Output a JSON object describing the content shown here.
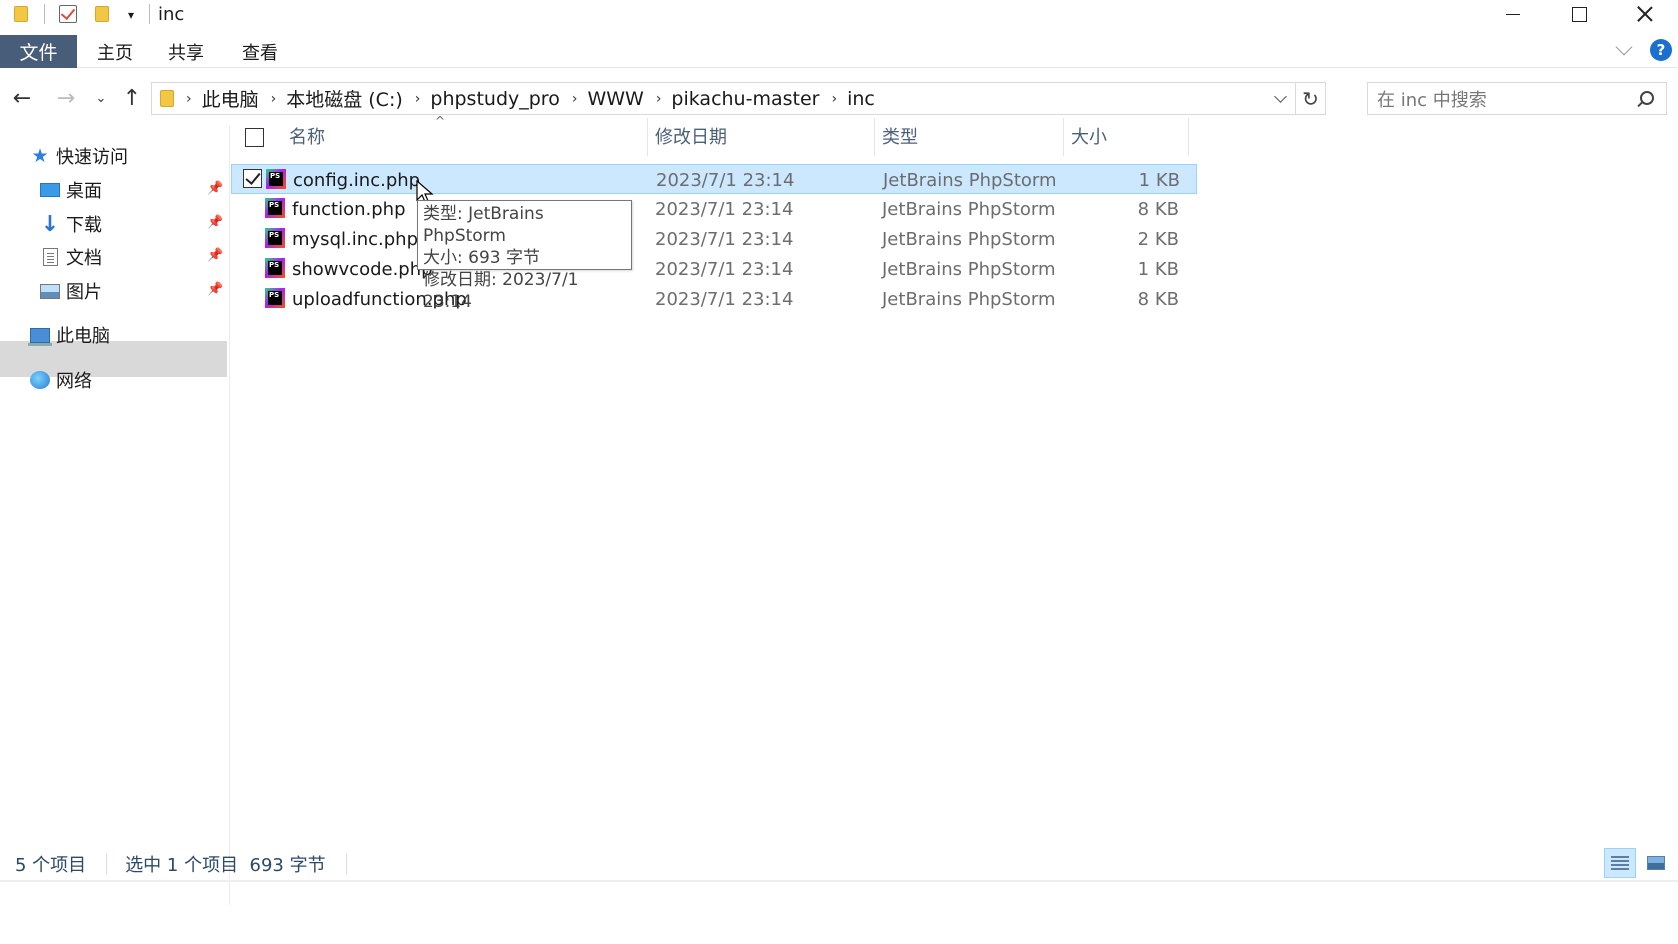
{
  "window": {
    "title": "inc"
  },
  "ribbon": {
    "file_tab": "文件",
    "tabs": [
      "主页",
      "共享",
      "查看"
    ]
  },
  "address": {
    "crumbs": [
      "此电脑",
      "本地磁盘 (C:)",
      "phpstudy_pro",
      "WWW",
      "pikachu-master",
      "inc"
    ]
  },
  "search": {
    "placeholder": "在 inc 中搜索"
  },
  "sidebar": {
    "quick_access": "快速访问",
    "items": [
      {
        "label": "桌面",
        "icon": "desktop-icon"
      },
      {
        "label": "下载",
        "icon": "download-icon"
      },
      {
        "label": "文档",
        "icon": "document-icon"
      },
      {
        "label": "图片",
        "icon": "pictures-icon"
      }
    ],
    "this_pc": "此电脑",
    "network": "网络"
  },
  "columns": {
    "name": "名称",
    "modified": "修改日期",
    "type": "类型",
    "size": "大小"
  },
  "files": [
    {
      "name": "config.inc.php",
      "modified": "2023/7/1 23:14",
      "type": "JetBrains PhpStorm",
      "size": "1 KB",
      "selected": true
    },
    {
      "name": "function.php",
      "modified": "2023/7/1 23:14",
      "type": "JetBrains PhpStorm",
      "size": "8 KB",
      "selected": false
    },
    {
      "name": "mysql.inc.php",
      "modified": "2023/7/1 23:14",
      "type": "JetBrains PhpStorm",
      "size": "2 KB",
      "selected": false
    },
    {
      "name": "showvcode.php",
      "modified": "2023/7/1 23:14",
      "type": "JetBrains PhpStorm",
      "size": "1 KB",
      "selected": false
    },
    {
      "name": "uploadfunction.php",
      "modified": "2023/7/1 23:14",
      "type": "JetBrains PhpStorm",
      "size": "8 KB",
      "selected": false
    }
  ],
  "tooltip": {
    "line1": "类型: JetBrains PhpStorm",
    "line2": "大小: 693 字节",
    "line3": "修改日期: 2023/7/1 23:14"
  },
  "status": {
    "count": "5 个项目",
    "selection": "选中 1 个项目  693 字节"
  },
  "colors": {
    "selection_bg": "#cce8ff",
    "file_tab_bg": "#475d7a",
    "accent": "#1a6fd1"
  }
}
